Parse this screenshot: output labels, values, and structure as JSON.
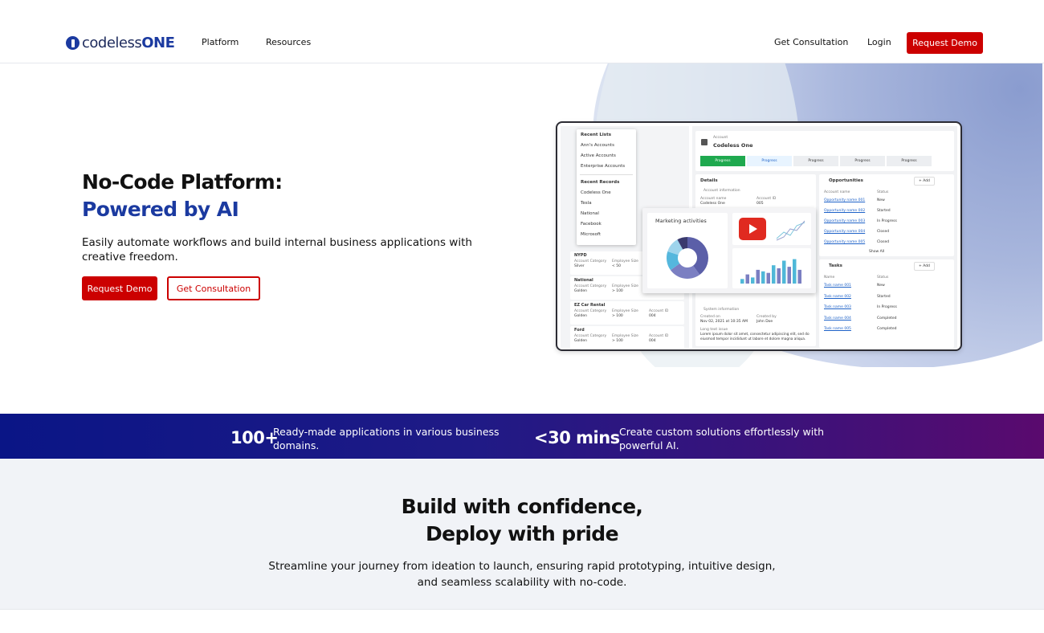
{
  "nav": {
    "logo_prefix": "codeless",
    "logo_suffix": "ONE",
    "links": [
      "Platform",
      "Resources"
    ],
    "consultation": "Get Consultation",
    "login": "Login",
    "request_demo": "Request Demo"
  },
  "hero": {
    "title_line1": "No-Code Platform:",
    "title_line2": "Powered by AI",
    "subtitle": "Easily automate workflows and build internal business applications with creative freedom.",
    "primary_button": "Request Demo",
    "secondary_button": "Get Consultation"
  },
  "mockup": {
    "recent_lists_title": "Recent Lists",
    "recent_lists": [
      "Ann's Accounts",
      "Active Accounts",
      "Enterprise Accounts"
    ],
    "recent_records_title": "Recent Records",
    "recent_records": [
      "Codeless One",
      "Tesla",
      "National",
      "Facebook",
      "Microsoft"
    ],
    "account_cards": [
      {
        "name": "NYPD",
        "category": "Silver",
        "size": "< 50",
        "id": ""
      },
      {
        "name": "National",
        "category": "Golden",
        "size": "> 100",
        "id": ""
      },
      {
        "name": "EZ Car Rental",
        "category": "Golden",
        "size": "> 100",
        "id": "004"
      },
      {
        "name": "Ford",
        "category": "Golden",
        "size": "> 100",
        "id": "004"
      }
    ],
    "account_labels": {
      "category": "Account Category",
      "size": "Employee Size",
      "id": "Account ID"
    },
    "record_kicker": "Account",
    "record_title": "Codeless One",
    "stages": [
      "Progress",
      "Progress",
      "Progress",
      "Progress",
      "Progress"
    ],
    "details_title": "Details",
    "account_info_title": "Account information",
    "account_name_label": "Account name",
    "account_name": "Codeless One",
    "account_id_label": "Account ID",
    "account_id": "005",
    "system_info_title": "System information",
    "created_on_label": "Created on",
    "created_on": "Nov 02, 2021 at 10:35 AM",
    "created_by_label": "Created by",
    "created_by": "John Doe",
    "long_text_label": "Long text issue",
    "long_text": "Lorem ipsum dolor sit amet, consectetur adipiscing elit, sed do eiusmod tempor incididunt ut labore et dolore magna aliqua.",
    "opportunities_title": "Opportunities",
    "add_label": "+ Add",
    "col_name": "Account name",
    "col_status": "Status",
    "opportunities": [
      {
        "name": "Opportunity name 001",
        "status": "New"
      },
      {
        "name": "Opportunity name 002",
        "status": "Started"
      },
      {
        "name": "Opportunity name 003",
        "status": "In Progress"
      },
      {
        "name": "Opportunity name 004",
        "status": "Closed"
      },
      {
        "name": "Opportunity name 005",
        "status": "Closed"
      }
    ],
    "show_all": "Show All",
    "tasks_title": "Tasks",
    "task_col_name": "Name",
    "tasks": [
      {
        "name": "Task name 001",
        "status": "New"
      },
      {
        "name": "Task name 002",
        "status": "Started"
      },
      {
        "name": "Task name 003",
        "status": "In Progress"
      },
      {
        "name": "Task name 004",
        "status": "Completed"
      },
      {
        "name": "Task name 005",
        "status": "Completed"
      }
    ],
    "popup_title": "Marketing activities",
    "donut_values": [
      40,
      25,
      15,
      12,
      8
    ],
    "bar_values": [
      0.15,
      0.3,
      0.2,
      0.45,
      0.4,
      0.35,
      0.6,
      0.5,
      0.75,
      0.55,
      0.8,
      0.45
    ],
    "colors": {
      "stage_active": "#1fa94f",
      "link": "#1e62c8",
      "play": "#e02a20"
    }
  },
  "stats": [
    {
      "value": "100+",
      "text": "Ready-made applications in various business domains."
    },
    {
      "value": "<30 mins",
      "text": "Create custom solutions effortlessly with powerful AI."
    }
  ],
  "build": {
    "title_line1": "Build with confidence,",
    "title_line2": "Deploy with pride",
    "description": "Streamline your journey from ideation to launch, ensuring rapid prototyping, intuitive design, and seamless scalability with no-code."
  },
  "colors": {
    "brand_red": "#cc0000",
    "brand_blue": "#1b3aa0"
  }
}
